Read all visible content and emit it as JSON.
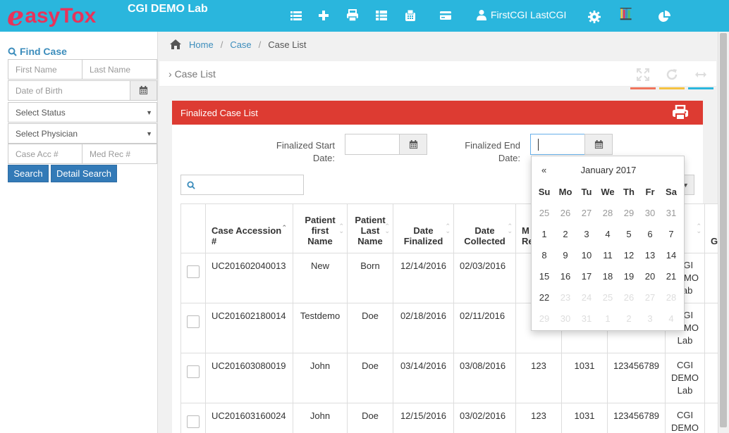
{
  "header": {
    "logo_first": "e",
    "logo_rest": "asyTox",
    "lab_name": "CGI DEMO Lab",
    "user_name": "FirstCGI LastCGI",
    "bg_color": "#2ab6dd"
  },
  "sidebar": {
    "title": "Find Case",
    "first_name_placeholder": "First Name",
    "last_name_placeholder": "Last Name",
    "dob_placeholder": "Date of Birth",
    "status_select": "Select Status",
    "physician_select": "Select Physician",
    "case_acc_placeholder": "Case Acc #",
    "med_rec_placeholder": "Med Rec #",
    "search_label": "Search",
    "detail_search_label": "Detail Search"
  },
  "breadcrumb": {
    "home": "Home",
    "case": "Case",
    "current": "Case List"
  },
  "panel": {
    "title": "Case List",
    "accent_colors": [
      "#f0735b",
      "#f5c242",
      "#2ab6dd"
    ]
  },
  "finalized": {
    "title": "Finalized Case List",
    "start_label_1": "Finalized Start",
    "start_label_2": "Date:",
    "end_label_1": "Finalized End",
    "end_label_2": "Date:",
    "header_color": "#dd3b32"
  },
  "table": {
    "headers": [
      {
        "l1": "",
        "l2": "",
        "l3": "Case Accession #"
      },
      {
        "l1": "Patient",
        "l2": "first",
        "l3": "Name"
      },
      {
        "l1": "Patient",
        "l2": "Last",
        "l3": "Name"
      },
      {
        "l1": "",
        "l2": "Date",
        "l3": "Finalized"
      },
      {
        "l1": "",
        "l2": "Date",
        "l3": "Collected"
      },
      {
        "l1": "",
        "l2": "M",
        "l3": "Re"
      },
      {
        "l1": "",
        "l2": "",
        "l3": ""
      },
      {
        "l1": "",
        "l2": "",
        "l3": ""
      },
      {
        "l1": "",
        "l2": "",
        "l3": "ab"
      },
      {
        "l1": "",
        "l2": "",
        "l3": "G"
      }
    ],
    "rows": [
      {
        "acc": "UC201602040013",
        "first": "New",
        "last": "Born",
        "finalized": "12/14/2016",
        "collected": "02/03/2016",
        "c6": "",
        "c7": "",
        "c8": "",
        "lab1": "CGI",
        "lab2": "DEMO",
        "lab3": "Lab"
      },
      {
        "acc": "UC201602180014",
        "first": "Testdemo",
        "last": "Doe",
        "finalized": "02/18/2016",
        "collected": "02/11/2016",
        "c6": "",
        "c7": "",
        "c8": "",
        "lab1": "CGI",
        "lab2": "DEMO",
        "lab3": "Lab"
      },
      {
        "acc": "UC201603080019",
        "first": "John",
        "last": "Doe",
        "finalized": "03/14/2016",
        "collected": "03/08/2016",
        "c6": "123",
        "c7": "1031",
        "c8": "123456789",
        "lab1": "CGI",
        "lab2": "DEMO",
        "lab3": "Lab"
      },
      {
        "acc": "UC201603160024",
        "first": "John",
        "last": "Doe",
        "finalized": "12/15/2016",
        "collected": "03/02/2016",
        "c6": "123",
        "c7": "1031",
        "c8": "123456789",
        "lab1": "CGI",
        "lab2": "DEMO",
        "lab3": ""
      }
    ]
  },
  "datepicker": {
    "prev": "«",
    "month": "January 2017",
    "weekdays": [
      "Su",
      "Mo",
      "Tu",
      "We",
      "Th",
      "Fr",
      "Sa"
    ],
    "weeks": [
      [
        "25",
        "26",
        "27",
        "28",
        "29",
        "30",
        "31"
      ],
      [
        "1",
        "2",
        "3",
        "4",
        "5",
        "6",
        "7"
      ],
      [
        "8",
        "9",
        "10",
        "11",
        "12",
        "13",
        "14"
      ],
      [
        "15",
        "16",
        "17",
        "18",
        "19",
        "20",
        "21"
      ],
      [
        "22",
        "23",
        "24",
        "25",
        "26",
        "27",
        "28"
      ],
      [
        "29",
        "30",
        "31",
        "1",
        "2",
        "3",
        "4"
      ]
    ]
  }
}
